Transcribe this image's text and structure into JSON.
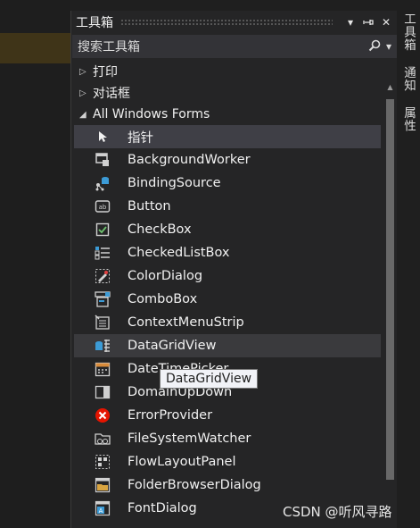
{
  "panel": {
    "title": "工具箱",
    "buttons": {
      "dropdown": "▾",
      "pin": "⊣",
      "close": "✕"
    }
  },
  "search": {
    "placeholder": "搜索工具箱",
    "icon": "search-icon",
    "dropdown": "▾"
  },
  "categories": [
    {
      "label": "打印",
      "expanded": false
    },
    {
      "label": "对话框",
      "expanded": false
    },
    {
      "label": "All Windows Forms",
      "expanded": true
    }
  ],
  "items": [
    {
      "label": "指针",
      "icon": "pointer-icon"
    },
    {
      "label": "BackgroundWorker",
      "icon": "background-worker-icon"
    },
    {
      "label": "BindingSource",
      "icon": "binding-source-icon"
    },
    {
      "label": "Button",
      "icon": "button-icon"
    },
    {
      "label": "CheckBox",
      "icon": "checkbox-icon"
    },
    {
      "label": "CheckedListBox",
      "icon": "checked-listbox-icon"
    },
    {
      "label": "ColorDialog",
      "icon": "color-dialog-icon"
    },
    {
      "label": "ComboBox",
      "icon": "combobox-icon"
    },
    {
      "label": "ContextMenuStrip",
      "icon": "context-menu-icon"
    },
    {
      "label": "DataGridView",
      "icon": "datagridview-icon"
    },
    {
      "label": "DateTimePicker",
      "icon": "datetimepicker-icon"
    },
    {
      "label": "DomainUpDown",
      "icon": "domain-updown-icon"
    },
    {
      "label": "ErrorProvider",
      "icon": "error-provider-icon"
    },
    {
      "label": "FileSystemWatcher",
      "icon": "filesystem-watcher-icon"
    },
    {
      "label": "FlowLayoutPanel",
      "icon": "flow-layout-icon"
    },
    {
      "label": "FolderBrowserDialog",
      "icon": "folder-browser-icon"
    },
    {
      "label": "FontDialog",
      "icon": "font-dialog-icon"
    }
  ],
  "tooltip": "DataGridView",
  "side_tabs": [
    "工具箱",
    "通知",
    "属性"
  ],
  "watermark": "CSDN @听风寻路",
  "colors": {
    "background": "#1f1f1f",
    "panel": "#252526",
    "selected": "#3f3f46",
    "error_red": "#e51400",
    "icon_blue": "#3c9bd6"
  }
}
